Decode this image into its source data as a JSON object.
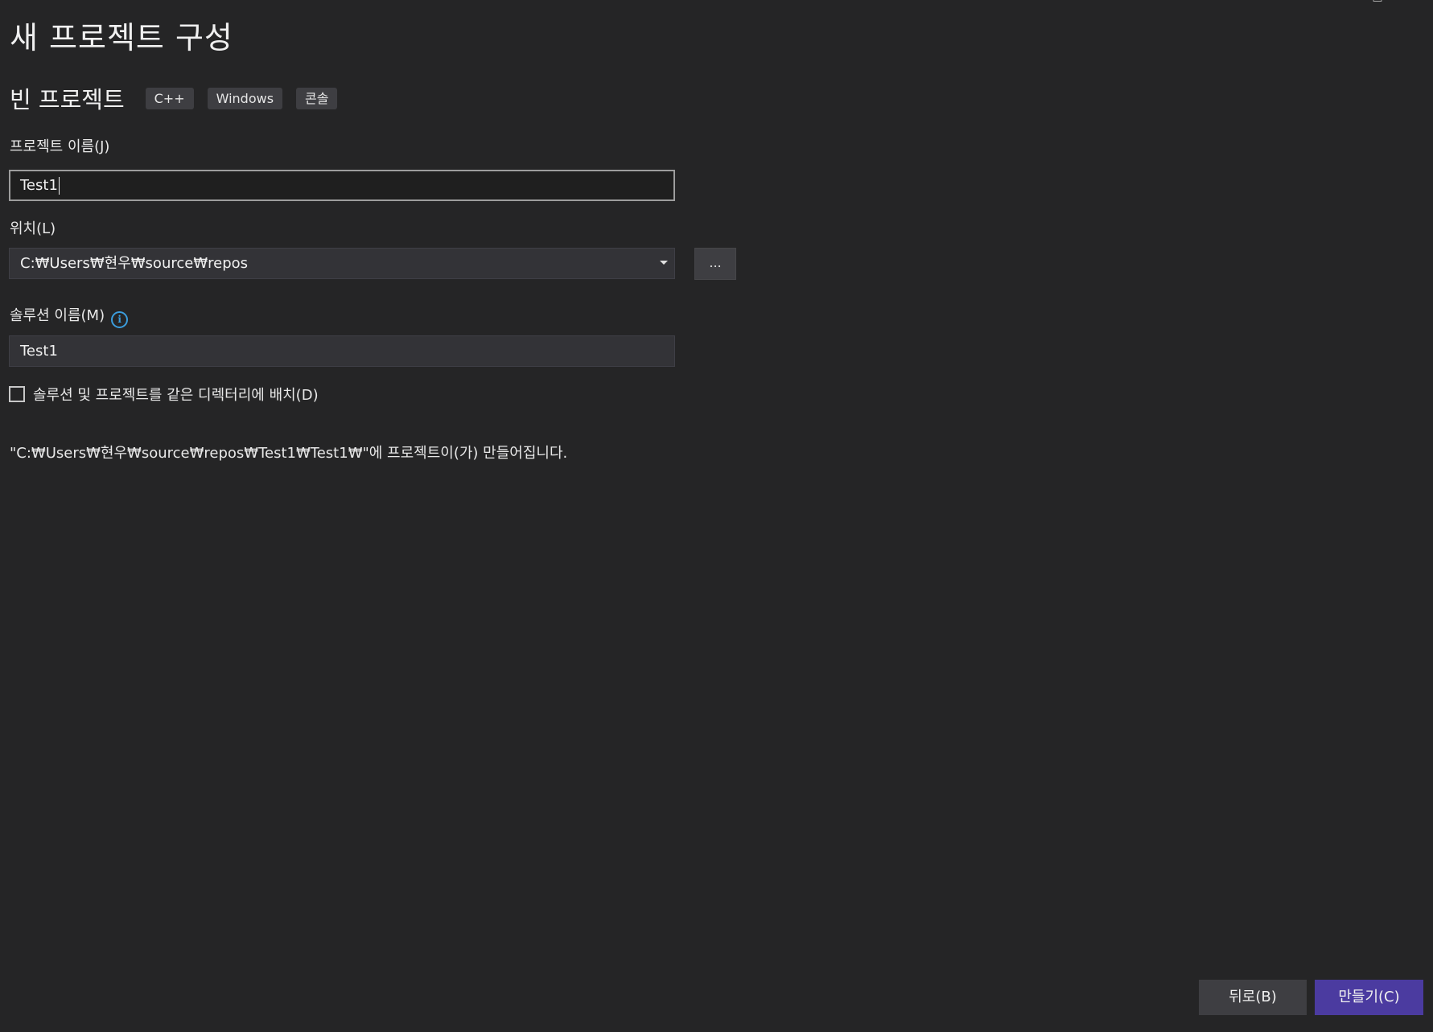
{
  "window": {
    "maximize_glyph": "□",
    "close_glyph": "✕"
  },
  "page": {
    "title": "새 프로젝트 구성"
  },
  "template": {
    "name": "빈 프로젝트",
    "tags": [
      "C++",
      "Windows",
      "콘솔"
    ]
  },
  "project_name": {
    "label": "프로젝트 이름(J)",
    "value": "Test1"
  },
  "location": {
    "label": "위치(L)",
    "value": "C:₩Users₩현우₩source₩repos",
    "browse_label": "..."
  },
  "solution_name": {
    "label": "솔루션 이름(M)",
    "value": "Test1",
    "info_icon": "i"
  },
  "same_directory": {
    "label": "솔루션 및 프로젝트를 같은 디렉터리에 배치(D)",
    "checked": false
  },
  "path_info": "\"C:₩Users₩현우₩source₩repos₩Test1₩Test1₩\"에 프로젝트이(가) 만들어집니다.",
  "footer": {
    "back_label": "뒤로(B)",
    "create_label": "만들기(C)"
  },
  "colors": {
    "background": "#252526",
    "accent": "#4b3ba0",
    "info": "#3b9ddd"
  }
}
